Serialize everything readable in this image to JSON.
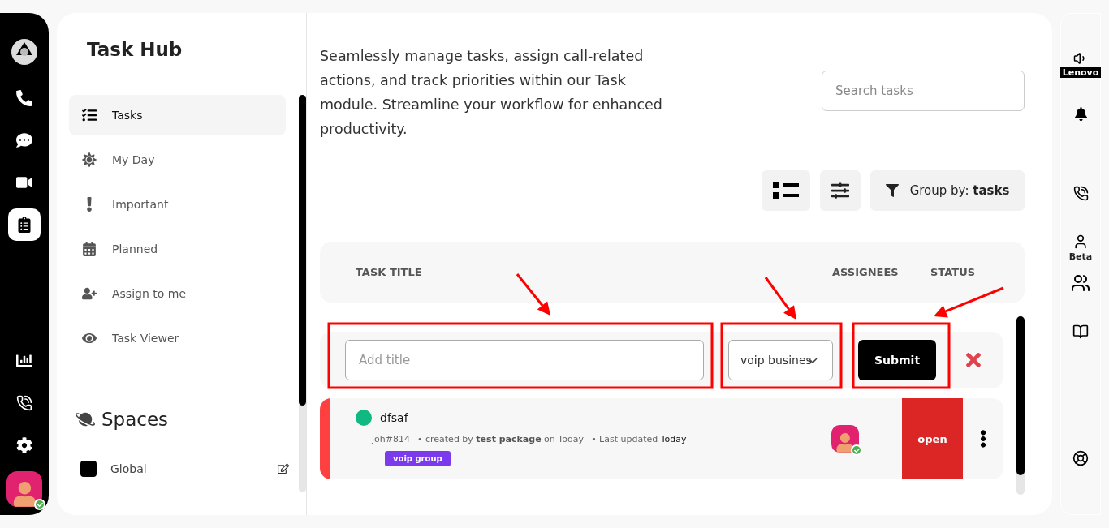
{
  "left_rail": {
    "items": [
      {
        "selected": false
      },
      {
        "selected": false
      },
      {
        "selected": false
      },
      {
        "selected": true
      },
      {
        "selected": false
      },
      {
        "selected": false
      },
      {
        "selected": false
      }
    ],
    "user_online": true
  },
  "sidebar": {
    "title": "Task Hub",
    "items": [
      {
        "label": "Tasks",
        "selected": true
      },
      {
        "label": "My Day",
        "selected": false
      },
      {
        "label": "Important",
        "selected": false
      },
      {
        "label": "Planned",
        "selected": false
      },
      {
        "label": "Assign to me",
        "selected": false
      },
      {
        "label": "Task Viewer",
        "selected": false
      }
    ],
    "spaces_title": "Spaces",
    "spaces": [
      {
        "label": "Global",
        "color": "#000000"
      }
    ]
  },
  "intro": "Seamlessly manage tasks, assign call-related actions, and track priorities within our Task module. Streamline your workflow for enhanced productivity.",
  "search": {
    "placeholder": "Search tasks"
  },
  "group_by": {
    "label": "Group by:",
    "value": "tasks"
  },
  "table": {
    "columns": [
      "TASK TITLE",
      "ASSIGNEES",
      "STATUS"
    ],
    "new_task": {
      "title_placeholder": "Add title",
      "group_value": "voip busines",
      "submit": "Submit"
    },
    "rows": [
      {
        "title": "dfsaf",
        "status_dot": {
          "color": "#10b981"
        },
        "priority": {
          "color": "#ff4040"
        },
        "id": "joh#814",
        "created": "• created by **test package** on Today",
        "updated": "• Last updated **Today**",
        "tag": {
          "label": "voip group",
          "color": "#7c3aed"
        },
        "assignee_online": true,
        "status": {
          "label": "open",
          "color": "#dc2626"
        }
      }
    ]
  },
  "right_rail": {
    "device_label": "Lenovo",
    "user_label": "Beta"
  }
}
